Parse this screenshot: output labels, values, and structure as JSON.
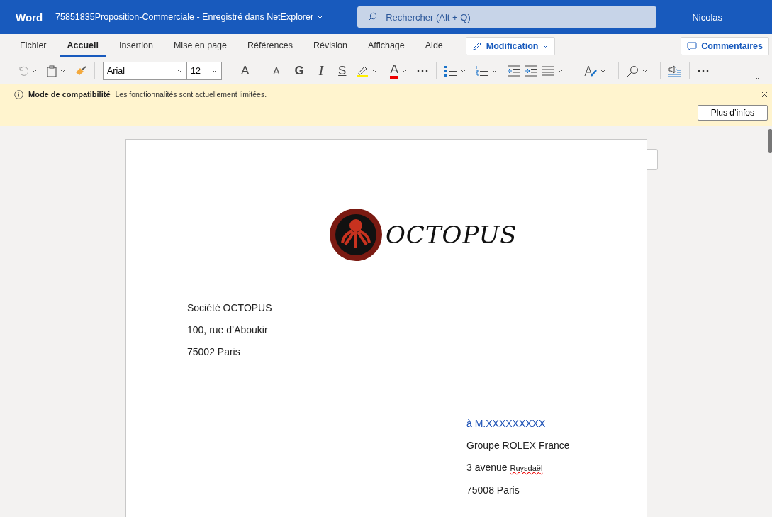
{
  "title_bar": {
    "app": "Word",
    "document": "75851835Proposition-Commerciale  -  Enregistré dans NetExplorer",
    "search": {
      "placeholder": "Rechercher (Alt + Q)"
    },
    "user": "Nicolas"
  },
  "tabs": [
    {
      "label": "Fichier",
      "selected": false
    },
    {
      "label": "Accueil",
      "selected": true
    },
    {
      "label": "Insertion",
      "selected": false
    },
    {
      "label": "Mise en page",
      "selected": false
    },
    {
      "label": "Références",
      "selected": false
    },
    {
      "label": "Révision",
      "selected": false
    },
    {
      "label": "Affichage",
      "selected": false
    },
    {
      "label": "Aide",
      "selected": false
    }
  ],
  "mode_button": "Modification",
  "comments_button": "Commentaires",
  "toolbar": {
    "font": "Arial",
    "size": "12",
    "glyphs": [
      {
        "kind": "grow",
        "label": "A"
      },
      {
        "kind": "shrink",
        "label": "A"
      },
      {
        "kind": "bold",
        "label": "G"
      },
      {
        "kind": "italic",
        "label": "I"
      },
      {
        "kind": "underline",
        "label": "S"
      }
    ],
    "font_color_label": "A"
  },
  "info_bar": {
    "title": "Mode de compatibilité",
    "message": "Les fonctionnalités sont actuellement limitées.",
    "button": "Plus d’infos"
  },
  "document": {
    "logo_text": "OCTOPUS",
    "sender": [
      "Société OCTOPUS",
      "100, rue d’Aboukir",
      "75002 Paris"
    ],
    "recipient": [
      {
        "kind": "link",
        "text": "à M.XXXXXXXXX"
      },
      {
        "kind": "plain",
        "text": "Groupe ROLEX France"
      },
      {
        "kind": "misspelled",
        "text": "3 avenue",
        "flagged": "Ruysdaël"
      },
      {
        "kind": "plain",
        "text": "75008 Paris"
      }
    ]
  }
}
